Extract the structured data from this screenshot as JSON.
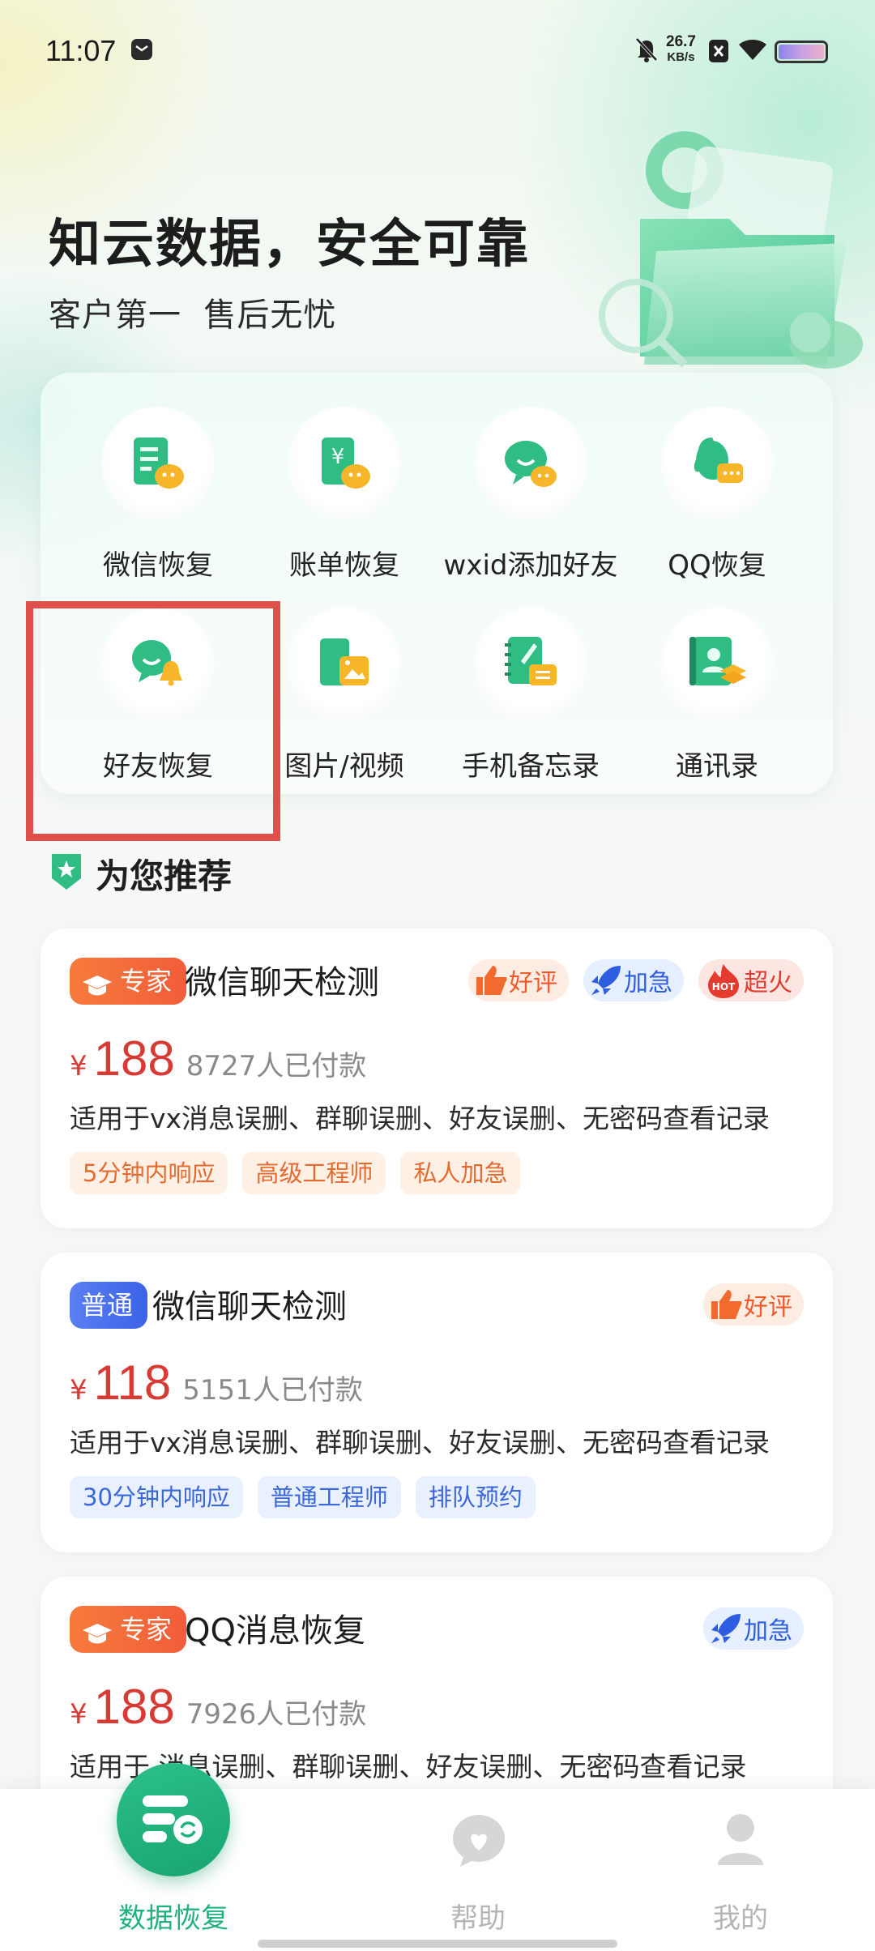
{
  "status_bar": {
    "time": "11:07",
    "net_speed_value": "26.7",
    "net_speed_unit": "KB/s",
    "icons": [
      "notification-icon",
      "mute-icon",
      "sim-off-icon",
      "wifi-icon",
      "battery-icon"
    ]
  },
  "hero": {
    "title": "知云数据，安全可靠",
    "subtitle": "客户第一  售后无忧"
  },
  "functions": [
    {
      "label": "微信恢复",
      "icon": "wechat-recovery-icon"
    },
    {
      "label": "账单恢复",
      "icon": "bill-recovery-icon"
    },
    {
      "label": "wxid添加好友",
      "icon": "wxid-add-friend-icon"
    },
    {
      "label": "QQ恢复",
      "icon": "qq-recovery-icon"
    },
    {
      "label": "好友恢复",
      "icon": "friend-recovery-icon"
    },
    {
      "label": "图片/视频",
      "icon": "photo-video-icon"
    },
    {
      "label": "手机备忘录",
      "icon": "memo-icon"
    },
    {
      "label": "通讯录",
      "icon": "contacts-icon"
    }
  ],
  "recommend": {
    "title": "为您推荐"
  },
  "products": [
    {
      "badge": "专家",
      "title": "微信聊天检测",
      "tags": [
        "好评",
        "加急",
        "超火"
      ],
      "yen": "¥",
      "price": "188",
      "paid": "8727人已付款",
      "desc": "适用于vx消息误删、群聊误删、好友误删、无密码查看记录",
      "chips": [
        "5分钟内响应",
        "高级工程师",
        "私人加急"
      ]
    },
    {
      "badge": "普通",
      "title": "微信聊天检测",
      "tags": [
        "好评"
      ],
      "yen": "¥",
      "price": "118",
      "paid": "5151人已付款",
      "desc": "适用于vx消息误删、群聊误删、好友误删、无密码查看记录",
      "chips": [
        "30分钟内响应",
        "普通工程师",
        "排队预约"
      ]
    },
    {
      "badge": "专家",
      "title": "QQ消息恢复",
      "tags": [
        "加急"
      ],
      "yen": "¥",
      "price": "188",
      "paid": "7926人已付款",
      "desc": "适用于 消息误删、群聊误删、好友误删、无密码查看记录"
    }
  ],
  "tabbar": {
    "tabs": [
      "数据恢复",
      "帮助",
      "我的"
    ],
    "active_color": "#1fb27c",
    "inactive_color": "#b5b5b5"
  },
  "colors": {
    "brand_green": "#1fb27c",
    "price_red": "#d83a34",
    "highlight_red": "#e0504a"
  }
}
